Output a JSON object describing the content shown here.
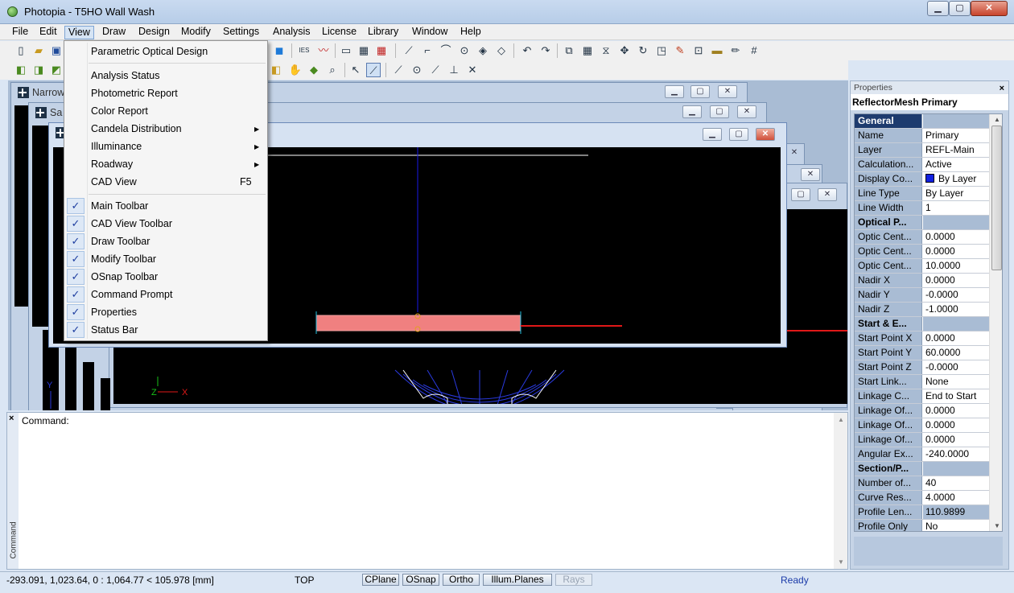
{
  "app": {
    "title": "Photopia - T5HO Wall Wash"
  },
  "window_controls": {
    "minimize": "▁",
    "maximize": "▢",
    "close": "✕"
  },
  "menubar": [
    "File",
    "Edit",
    "View",
    "Draw",
    "Design",
    "Modify",
    "Settings",
    "Analysis",
    "License",
    "Library",
    "Window",
    "Help"
  ],
  "view_menu": {
    "items": [
      {
        "label": "Parametric Optical Design"
      },
      {
        "label": "Analysis Status"
      },
      {
        "label": "Photometric Report"
      },
      {
        "label": "Color Report"
      },
      {
        "label": "Candela Distribution",
        "submenu": true
      },
      {
        "label": "Illuminance",
        "submenu": true
      },
      {
        "label": "Roadway",
        "submenu": true
      },
      {
        "label": "CAD View",
        "shortcut": "F5"
      },
      {
        "label": "Main Toolbar",
        "checked": true
      },
      {
        "label": "CAD View Toolbar",
        "checked": true
      },
      {
        "label": "Draw Toolbar",
        "checked": true
      },
      {
        "label": "Modify Toolbar",
        "checked": true
      },
      {
        "label": "OSnap Toolbar",
        "checked": true
      },
      {
        "label": "Command Prompt",
        "checked": true
      },
      {
        "label": "Properties",
        "checked": true
      },
      {
        "label": "Status Bar",
        "checked": true
      }
    ],
    "check_glyph": "✓",
    "arrow_glyph": "▶"
  },
  "mdi": {
    "back_window_title": "Narrow",
    "mid_window_title": "Sa",
    "axis_labels": {
      "x": "X",
      "y": "Y",
      "z": "Z"
    }
  },
  "command": {
    "close": "×",
    "prompt": "Command:",
    "side_label": "Command"
  },
  "properties": {
    "header": "Properties",
    "close": "×",
    "object": "ReflectorMesh Primary",
    "rows": [
      {
        "name": "General",
        "category": true,
        "selected": true
      },
      {
        "name": "Name",
        "value": "Primary"
      },
      {
        "name": "Layer",
        "value": "REFL-Main"
      },
      {
        "name": "Calculation...",
        "value": "Active"
      },
      {
        "name": "Display Co...",
        "value": "By Layer",
        "swatch": "#1020e0"
      },
      {
        "name": "Line Type",
        "value": "By Layer"
      },
      {
        "name": "Line Width",
        "value": "1"
      },
      {
        "name": "Optical P...",
        "category": true
      },
      {
        "name": "Optic Cent...",
        "value": "0.0000"
      },
      {
        "name": "Optic Cent...",
        "value": "0.0000"
      },
      {
        "name": "Optic Cent...",
        "value": "10.0000"
      },
      {
        "name": "Nadir X",
        "value": "0.0000"
      },
      {
        "name": "Nadir Y",
        "value": "-0.0000"
      },
      {
        "name": "Nadir Z",
        "value": "-1.0000"
      },
      {
        "name": "Start & E...",
        "category": true
      },
      {
        "name": "Start Point X",
        "value": "0.0000"
      },
      {
        "name": "Start Point Y",
        "value": "60.0000"
      },
      {
        "name": "Start Point Z",
        "value": "-0.0000"
      },
      {
        "name": "Start Link...",
        "value": "None"
      },
      {
        "name": "Linkage C...",
        "value": "End to Start"
      },
      {
        "name": "Linkage Of...",
        "value": "0.0000"
      },
      {
        "name": "Linkage Of...",
        "value": "0.0000"
      },
      {
        "name": "Linkage Of...",
        "value": "0.0000"
      },
      {
        "name": "Angular Ex...",
        "value": "-240.0000"
      },
      {
        "name": "Section/P...",
        "category": true
      },
      {
        "name": "Number of...",
        "value": "40"
      },
      {
        "name": "Curve Res...",
        "value": "4.0000"
      },
      {
        "name": "Profile Len...",
        "value": "110.9899",
        "readonly": true
      },
      {
        "name": "Profile Only",
        "value": "No"
      }
    ]
  },
  "statusbar": {
    "coords": "-293.091, 1,023.64, 0 : 1,064.77 < 105.978 [mm]",
    "view": "TOP",
    "toggles": [
      {
        "label": "CPlane",
        "on": true
      },
      {
        "label": "OSnap",
        "on": true
      },
      {
        "label": "Ortho",
        "on": true
      },
      {
        "label": "Illum.Planes",
        "on": true
      },
      {
        "label": "Rays",
        "on": false
      }
    ],
    "state": "Ready"
  },
  "colors": {
    "accent_blue": "#1e3b6e",
    "status_ready": "#1a3aa8",
    "reflector_fill": "#f08080"
  }
}
